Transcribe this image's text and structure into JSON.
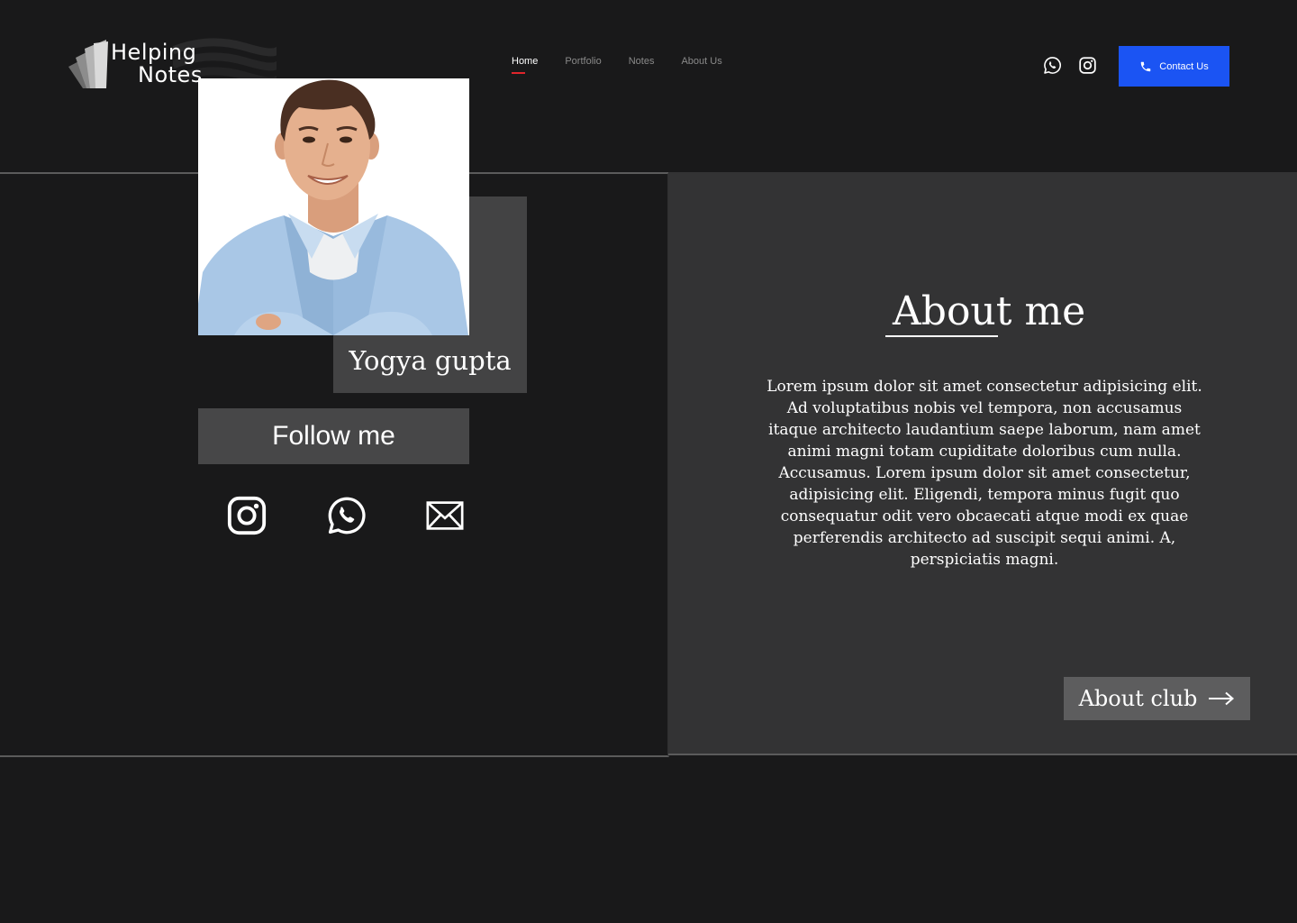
{
  "brand": {
    "line1": "Helping",
    "line2": "Notes"
  },
  "nav": {
    "items": [
      {
        "label": "Home",
        "active": true
      },
      {
        "label": "Portfolio",
        "active": false
      },
      {
        "label": "Notes",
        "active": false
      },
      {
        "label": "About Us",
        "active": false
      }
    ]
  },
  "header": {
    "icons": [
      "whatsapp-icon",
      "instagram-icon"
    ],
    "contact_label": "Contact Us"
  },
  "profile": {
    "name": "Yogya gupta",
    "follow_label": "Follow me",
    "social_icons": [
      "instagram-icon",
      "whatsapp-icon",
      "mail-icon"
    ]
  },
  "about": {
    "title": "About me",
    "body": "Lorem ipsum dolor sit amet consectetur adipisicing elit. Ad voluptatibus nobis vel tempora, non accusamus itaque architecto laudantium saepe laborum, nam amet animi magni totam cupiditate doloribus cum nulla. Accusamus. Lorem ipsum dolor sit amet consectetur, adipisicing elit. Eligendi, tempora minus fugit quo consequatur odit vero obcaecati atque modi ex quae perferendis architecto ad suscipit sequi animi. A, perspiciatis magni.",
    "club_label": "About club"
  },
  "colors": {
    "background": "#19191a",
    "panel": "#333334",
    "accent_blue": "#1b54f3",
    "nav_active_underline": "#e0252b"
  }
}
